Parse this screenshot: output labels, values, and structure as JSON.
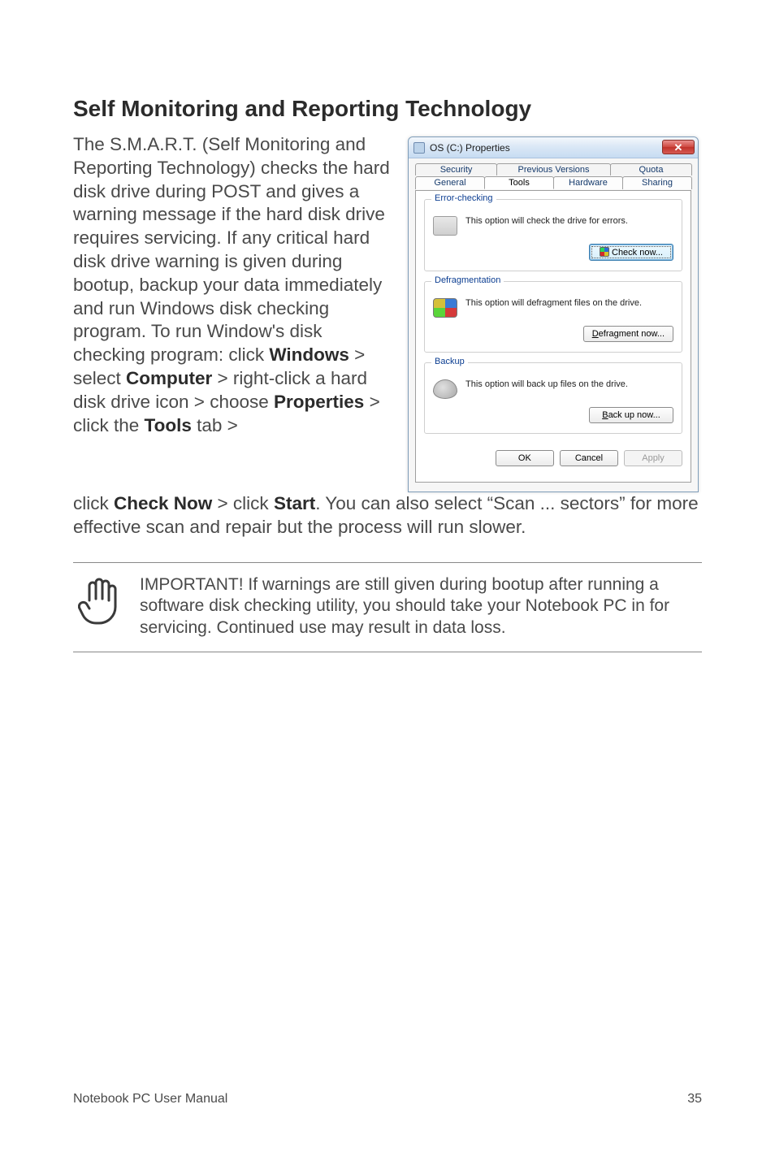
{
  "heading": "Self Monitoring and Reporting Technology",
  "para_wrap": "The S.M.A.R.T. (Self Monitoring and Reporting Technology) checks the hard disk drive during POST and gives a warning message if the hard disk drive requires servicing. If any critical hard disk drive warning is given during bootup, backup your data immediately and run Windows disk checking program. To run Window's disk checking program: click ",
  "b_windows": "Windows",
  "gt1": " > select ",
  "b_computer": "Computer",
  "txt_rc": " > right-click a hard disk drive icon > choose ",
  "b_properties": "Properties",
  "txt_click_the": " > click the ",
  "b_tools": "Tools",
  "txt_tab_gt": " tab > ",
  "after1": "click ",
  "b_checknow": "Check Now",
  "after2": " > click ",
  "b_start": "Start",
  "after3": ". You can also select “Scan ... sectors” for more effective scan and repair but the process will run slower.",
  "note": "IMPORTANT!  If warnings are still given during bootup after running a software disk checking utility, you should take your Notebook PC in for servicing. Continued use may result in data loss.",
  "footer_left": "Notebook PC User Manual",
  "footer_right": "35",
  "dialog": {
    "title": "OS (C:) Properties",
    "tabs_back": [
      "Security",
      "Previous Versions",
      "Quota"
    ],
    "tabs_front": [
      "General",
      "Tools",
      "Hardware",
      "Sharing"
    ],
    "group1": {
      "legend": "Error-checking",
      "text": "This option will check the drive for errors.",
      "btn": "Check now..."
    },
    "group2": {
      "legend": "Defragmentation",
      "text": "This option will defragment files on the drive.",
      "btn_u": "D",
      "btn_rest": "efragment now..."
    },
    "group3": {
      "legend": "Backup",
      "text": "This option will back up files on the drive.",
      "btn_u": "B",
      "btn_rest": "ack up now..."
    },
    "ok": "OK",
    "cancel": "Cancel",
    "apply": "Apply"
  },
  "chart_data": {
    "type": "table",
    "title": "",
    "categories": [],
    "values": []
  }
}
